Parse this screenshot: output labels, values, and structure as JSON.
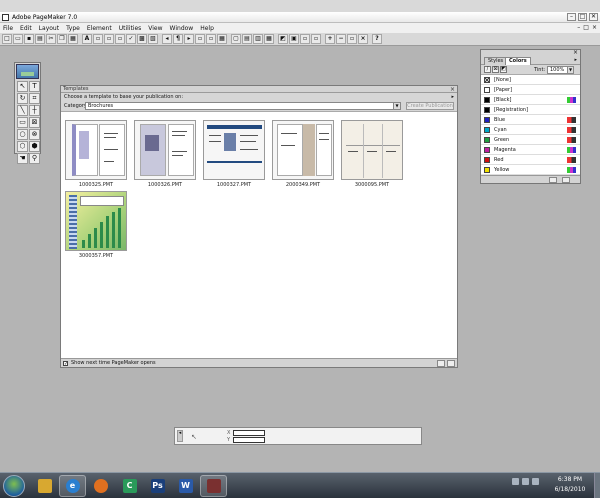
{
  "window": {
    "title": "Adobe PageMaker 7.0",
    "buttons": [
      "–",
      "□",
      "✕"
    ]
  },
  "menu": [
    "File",
    "Edit",
    "Layout",
    "Type",
    "Element",
    "Utilities",
    "View",
    "Window",
    "Help"
  ],
  "mdi_buttons": [
    "–",
    "□",
    "×"
  ],
  "toolbar": [
    "new-icon",
    "open-icon",
    "save-icon",
    "print-icon",
    "find-icon",
    "spell-icon",
    "text-icon",
    "bold-icon",
    "italic-icon",
    "underline-icon",
    "place-icon",
    "export-icon",
    "left-icon",
    "right-icon",
    "zoom-icon",
    "help-icon"
  ],
  "tools": [
    "arrow-icon",
    "text-icon",
    "rotate-icon",
    "crop-icon",
    "line-icon",
    "constrained-line-icon",
    "rectangle-icon",
    "rectangle-frame-icon",
    "ellipse-icon",
    "ellipse-frame-icon",
    "polygon-icon",
    "polygon-frame-icon",
    "hand-icon",
    "zoom-icon"
  ],
  "templates": {
    "title": "Templates",
    "instruction": "Choose a template to base your publication on:",
    "category_label": "Category:",
    "category_value": "Brochures",
    "create_button": "Create Publication",
    "show_next_time": "Show next time PageMaker opens",
    "show_next_time_checked": true,
    "items": [
      {
        "name": "1000325.PMT"
      },
      {
        "name": "1000326.PMT"
      },
      {
        "name": "1000327.PMT"
      },
      {
        "name": "2000349.PMT"
      },
      {
        "name": "3000095.PMT"
      },
      {
        "name": "3000357.PMT"
      }
    ]
  },
  "colors_palette": {
    "tabs": [
      "Styles",
      "Colors"
    ],
    "active_tab": "Colors",
    "tint_label": "Tint:",
    "tint_value": "100%",
    "colors": [
      {
        "name": "[None]",
        "swatch": "#ffffff"
      },
      {
        "name": "[Paper]",
        "swatch": "#ffffff"
      },
      {
        "name": "[Black]",
        "swatch": "#000000"
      },
      {
        "name": "[Registration]",
        "swatch": "#000000"
      },
      {
        "name": "Blue",
        "swatch": "#2020c0"
      },
      {
        "name": "Cyan",
        "swatch": "#00a8c8"
      },
      {
        "name": "Green",
        "swatch": "#20a040"
      },
      {
        "name": "Magenta",
        "swatch": "#c020a0"
      },
      {
        "name": "Red",
        "swatch": "#d01010"
      },
      {
        "name": "Yellow",
        "swatch": "#f0e000"
      }
    ]
  },
  "control_palette": {
    "x_label": "X",
    "y_label": "Y"
  },
  "taskbar": {
    "apps": [
      {
        "name": "folder-icon",
        "color": "#d8a830"
      },
      {
        "name": "internet-explorer-icon",
        "color": "#2a7fd0"
      },
      {
        "name": "firefox-icon",
        "color": "#e07020"
      },
      {
        "name": "camtasia-icon",
        "color": "#2a9a5a"
      },
      {
        "name": "photoshop-icon",
        "color": "#1a3f7a"
      },
      {
        "name": "word-icon",
        "color": "#2a5aa8"
      },
      {
        "name": "pagemaker-icon",
        "color": "#7a3030"
      }
    ],
    "time": "6:38 PM",
    "date": "6/18/2010"
  }
}
